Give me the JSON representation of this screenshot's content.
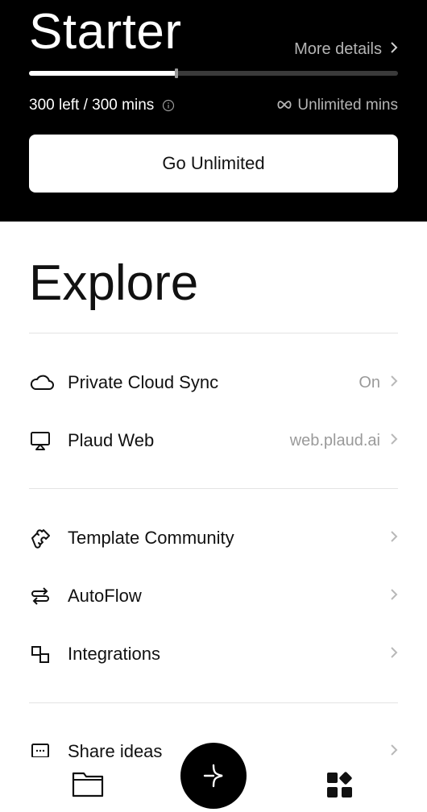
{
  "plan": {
    "title": "Starter",
    "more_details": "More details",
    "usage_text": "300 left / 300 mins",
    "unlimited_text": "Unlimited mins",
    "progress_fraction": 0.4,
    "cta_label": "Go Unlimited"
  },
  "explore": {
    "title": "Explore",
    "groups": [
      [
        {
          "icon": "cloud-icon",
          "label": "Private Cloud Sync",
          "value": "On"
        },
        {
          "icon": "monitor-icon",
          "label": "Plaud Web",
          "value": "web.plaud.ai"
        }
      ],
      [
        {
          "icon": "puzzle-icon",
          "label": "Template Community",
          "value": ""
        },
        {
          "icon": "autoflow-icon",
          "label": "AutoFlow",
          "value": ""
        },
        {
          "icon": "integrations-icon",
          "label": "Integrations",
          "value": ""
        }
      ],
      [
        {
          "icon": "chat-icon",
          "label": "Share ideas",
          "value": ""
        }
      ]
    ]
  },
  "bottom_nav": {
    "items": [
      {
        "icon": "folder-icon"
      },
      {
        "icon": "plus-icon"
      },
      {
        "icon": "apps-icon"
      }
    ]
  }
}
